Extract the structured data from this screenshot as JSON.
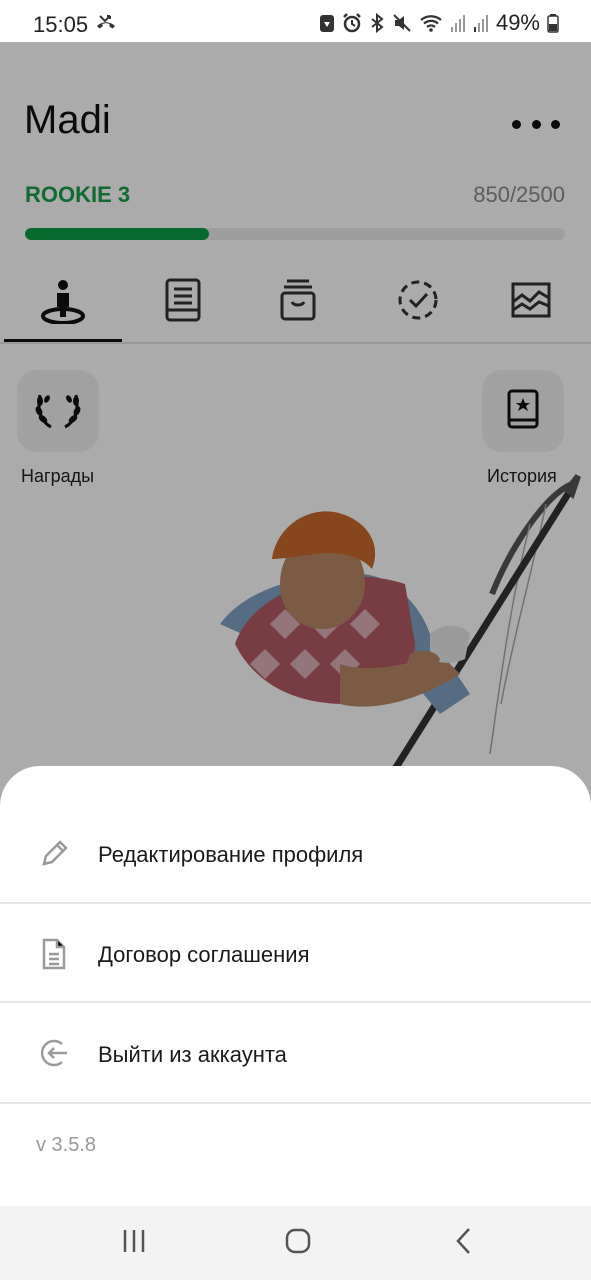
{
  "status_bar": {
    "time": "15:05",
    "battery": "49%",
    "icons": [
      "missed-call-icon",
      "app-notification-icon",
      "alarm-icon",
      "bluetooth-icon",
      "mute-icon",
      "wifi-icon",
      "signal-icon",
      "signal-icon-2",
      "battery-icon"
    ]
  },
  "header": {
    "title": "Madi",
    "menu_icon": "more-horizontal-icon"
  },
  "level": {
    "name": "ROOKIE 3",
    "score": "850/2500",
    "progress": 0.34,
    "accent_color": "#0c9d43"
  },
  "tabs": [
    {
      "icon": "person-on-spot-icon",
      "active": true
    },
    {
      "icon": "book-icon",
      "active": false
    },
    {
      "icon": "box-icon",
      "active": false
    },
    {
      "icon": "dashed-check-circle-icon",
      "active": false
    },
    {
      "icon": "area-chart-icon",
      "active": false
    }
  ],
  "side_buttons": {
    "awards": {
      "label": "Награды",
      "icon": "laurel-wreath-icon"
    },
    "history": {
      "label": "История",
      "icon": "star-book-icon"
    }
  },
  "character": {
    "icon": "golfer-illustration"
  },
  "sheet": {
    "items": [
      {
        "label": "Редактирование профиля",
        "icon": "pencil-icon"
      },
      {
        "label": "Договор соглашения",
        "icon": "document-icon"
      },
      {
        "label": "Выйти из аккаунта",
        "icon": "logout-icon"
      }
    ],
    "version": "v 3.5.8"
  },
  "nav_bar": {
    "buttons": [
      "recent-apps-icon",
      "home-icon",
      "back-icon"
    ]
  }
}
